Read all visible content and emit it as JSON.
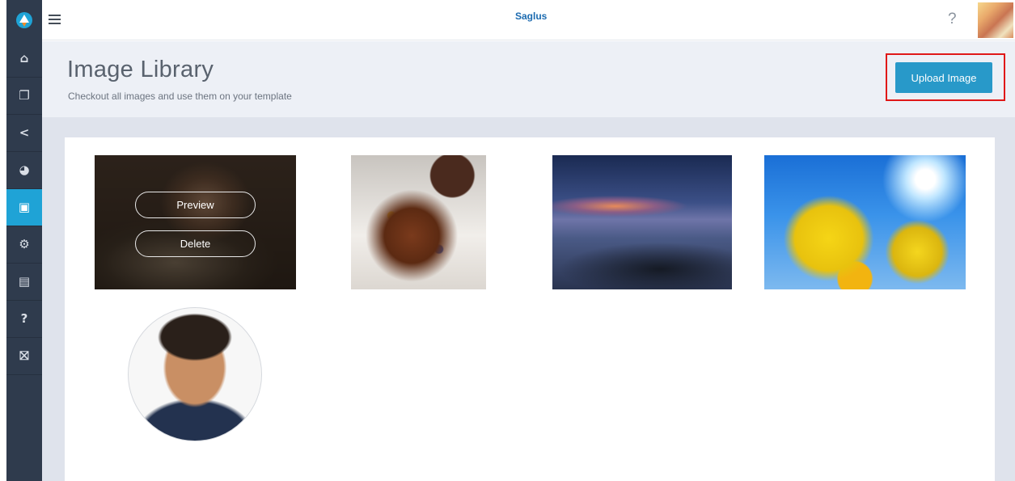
{
  "app": {
    "brand": "Saglus"
  },
  "header": {
    "help_label": "?"
  },
  "sidebar": {
    "items": [
      {
        "name": "home",
        "icon": "home-icon",
        "glyph": "⌂"
      },
      {
        "name": "templates",
        "icon": "copy-icon",
        "glyph": "❐"
      },
      {
        "name": "share",
        "icon": "share-icon",
        "glyph": "<"
      },
      {
        "name": "reports",
        "icon": "pie-chart-icon",
        "glyph": "◕"
      },
      {
        "name": "image-library",
        "icon": "image-icon",
        "glyph": "▣",
        "active": true
      },
      {
        "name": "settings",
        "icon": "gear-icon",
        "glyph": "⚙"
      },
      {
        "name": "billing",
        "icon": "receipt-icon",
        "glyph": "▤"
      },
      {
        "name": "help",
        "icon": "question-icon",
        "glyph": "?"
      },
      {
        "name": "gifts",
        "icon": "gift-icon",
        "glyph": "⛝"
      }
    ]
  },
  "page": {
    "title": "Image Library",
    "subtitle": "Checkout all images and use them on your template",
    "upload_label": "Upload Image"
  },
  "images": {
    "hover_actions": {
      "preview_label": "Preview",
      "delete_label": "Delete"
    },
    "items": [
      {
        "subject": "dog-photo"
      },
      {
        "subject": "candy-cake-photo"
      },
      {
        "subject": "seascape-photo"
      },
      {
        "subject": "lemonade-photo"
      },
      {
        "subject": "portrait-photo"
      }
    ]
  },
  "colors": {
    "sidebar_bg": "#2f3b4d",
    "sidebar_active": "#1fa3d6",
    "accent": "#2899c9",
    "highlight_border": "#e01818",
    "header_band": "#edf0f6"
  }
}
